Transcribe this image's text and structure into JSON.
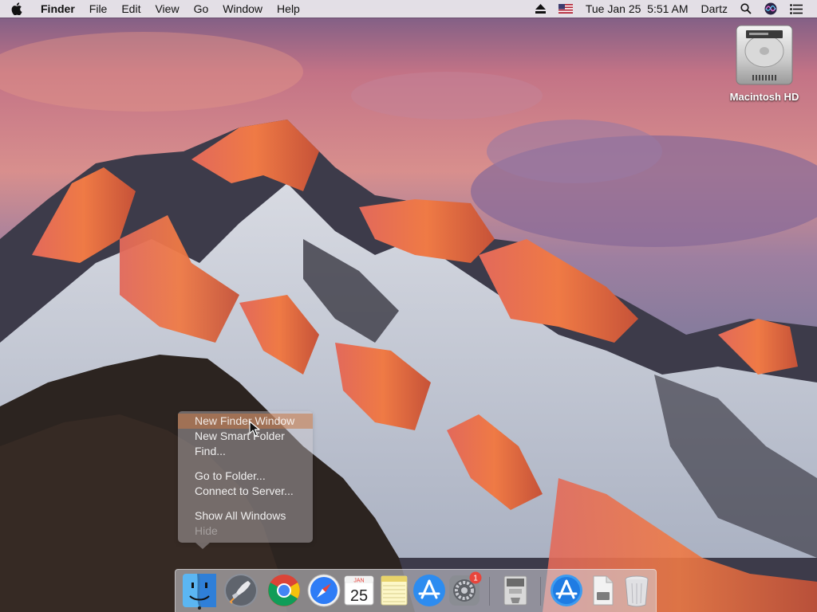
{
  "menubar": {
    "apple_icon": "apple-icon",
    "app_name": "Finder",
    "menus": [
      "File",
      "Edit",
      "View",
      "Go",
      "Window",
      "Help"
    ],
    "status": {
      "eject_icon": "eject-icon",
      "flag_icon": "us-flag-icon",
      "datetime": "Tue Jan 25  5:51 AM",
      "user": "Dartz",
      "search_icon": "spotlight-icon",
      "siri_icon": "siri-icon",
      "notification_icon": "notification-center-icon"
    }
  },
  "desktop": {
    "drive": {
      "label": "Macintosh HD",
      "icon": "hard-drive-icon"
    }
  },
  "dock_menu": {
    "items": [
      {
        "label": "New Finder Window",
        "state": "highlighted"
      },
      {
        "label": "New Smart Folder",
        "state": "normal"
      },
      {
        "label": "Find...",
        "state": "normal"
      },
      {
        "label": "Go to Folder...",
        "state": "normal"
      },
      {
        "label": "Connect to Server...",
        "state": "normal"
      },
      {
        "label": "Show All Windows",
        "state": "normal"
      },
      {
        "label": "Hide",
        "state": "disabled"
      }
    ]
  },
  "dock": {
    "apps": [
      {
        "name": "finder-icon",
        "running": true
      },
      {
        "name": "launchpad-icon",
        "running": false
      },
      {
        "name": "chrome-icon",
        "running": false
      },
      {
        "name": "safari-icon",
        "running": false
      },
      {
        "name": "calendar-icon",
        "running": false,
        "month": "JAN",
        "day": "25"
      },
      {
        "name": "notes-icon",
        "running": false
      },
      {
        "name": "app-store-icon",
        "running": false
      },
      {
        "name": "system-preferences-icon",
        "running": false,
        "badge": "1"
      },
      {
        "name": "disk-utility-icon",
        "running": false
      },
      {
        "name": "applications-folder-icon",
        "running": false
      },
      {
        "name": "downloads-stack-icon",
        "running": false
      },
      {
        "name": "trash-icon",
        "running": false
      }
    ]
  },
  "colors": {
    "menu_highlight": "#c8784a",
    "safari_blue": "#2e7cf6",
    "chrome_red": "#db4437",
    "chrome_yellow": "#f4c20d",
    "chrome_green": "#0f9d58",
    "badge_red": "#e8453c"
  }
}
